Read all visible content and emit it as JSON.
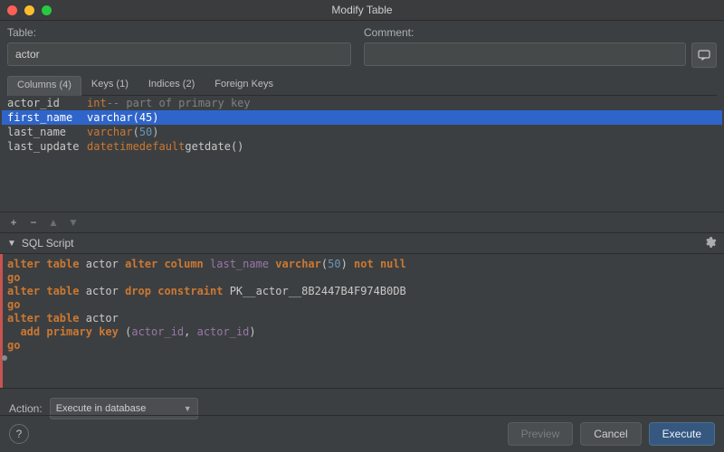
{
  "window": {
    "title": "Modify Table"
  },
  "fields": {
    "table_label": "Table:",
    "table_value": "actor",
    "comment_label": "Comment:",
    "comment_value": ""
  },
  "tabs": [
    {
      "label": "Columns (4)",
      "active": true
    },
    {
      "label": "Keys (1)",
      "active": false
    },
    {
      "label": "Indices (2)",
      "active": false
    },
    {
      "label": "Foreign Keys",
      "active": false
    }
  ],
  "columns": [
    {
      "name": "actor_id",
      "type_kw": "int",
      "extra": "-- part of primary key",
      "extra_kind": "comment",
      "selected": false
    },
    {
      "name": "first_name",
      "type_kw": "varchar",
      "paren_num": "45",
      "selected": true
    },
    {
      "name": "last_name",
      "type_kw": "varchar",
      "paren_num": "50",
      "selected": false
    },
    {
      "name": "last_update",
      "type_kw": "datetime",
      "type_kw2": "default",
      "tail_fn": "getdate()",
      "selected": false
    }
  ],
  "list_toolbar": {
    "add": "+",
    "remove": "−",
    "up": "▲",
    "down": "▼"
  },
  "sql_section": {
    "title": "SQL Script"
  },
  "sql_lines": [
    [
      {
        "kw": "alter"
      },
      " ",
      {
        "kw": "table"
      },
      " ",
      {
        "pl": "actor "
      },
      {
        "kw": "alter"
      },
      " ",
      {
        "kw": "column"
      },
      " ",
      {
        "id": "last_name"
      },
      " ",
      {
        "kw": "varchar"
      },
      {
        "pl": "("
      },
      {
        "num": "50"
      },
      {
        "pl": ") "
      },
      {
        "kw": "not"
      },
      " ",
      {
        "kw": "null"
      }
    ],
    [
      {
        "kw": "go"
      }
    ],
    [
      {
        "pl": ""
      }
    ],
    [
      {
        "kw": "alter"
      },
      " ",
      {
        "kw": "table"
      },
      " ",
      {
        "pl": "actor "
      },
      {
        "kw": "drop"
      },
      " ",
      {
        "kw": "constraint"
      },
      " ",
      {
        "pl": "PK__actor__8B2447B4F974B0DB"
      }
    ],
    [
      {
        "kw": "go"
      }
    ],
    [
      {
        "pl": ""
      }
    ],
    [
      {
        "kw": "alter"
      },
      " ",
      {
        "kw": "table"
      },
      " ",
      {
        "pl": "actor"
      }
    ],
    [
      {
        "pl": "  "
      },
      {
        "kw": "add"
      },
      " ",
      {
        "kw": "primary"
      },
      " ",
      {
        "kw": "key"
      },
      " ",
      {
        "pl": "("
      },
      {
        "id": "actor_id"
      },
      {
        "pl": ", "
      },
      {
        "id": "actor_id"
      },
      {
        "pl": ")"
      }
    ],
    [
      {
        "kw": "go"
      }
    ]
  ],
  "action": {
    "label": "Action:",
    "selected": "Execute in database"
  },
  "buttons": {
    "preview": "Preview",
    "cancel": "Cancel",
    "execute": "Execute"
  }
}
